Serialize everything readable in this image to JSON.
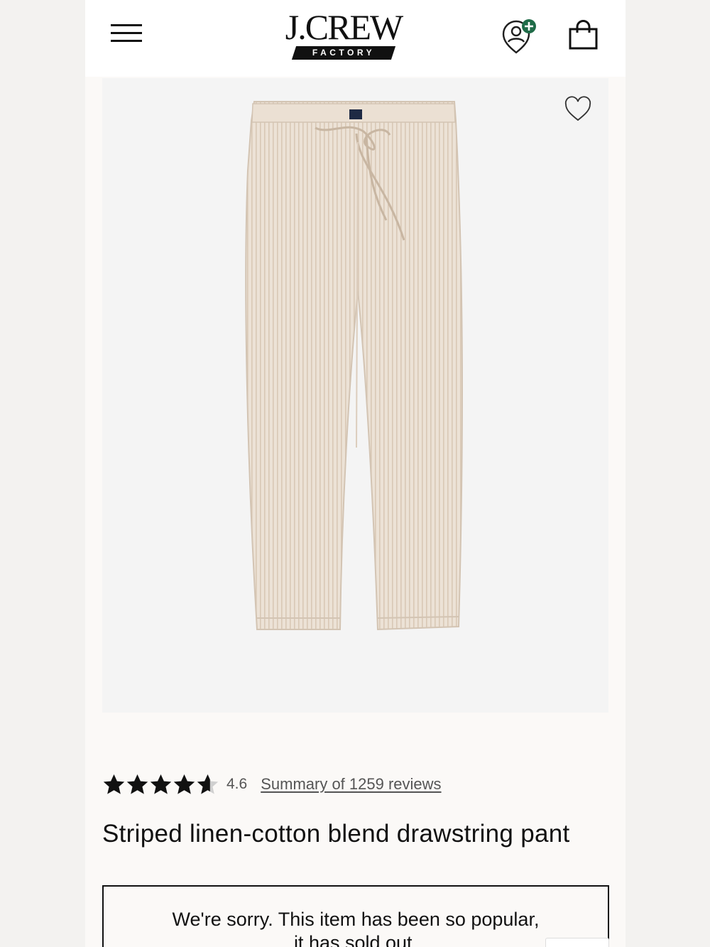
{
  "header": {
    "brand_name": "J.CREW",
    "brand_sub": "FACTORY",
    "icons": {
      "menu": "hamburger-menu-icon",
      "account": "account-add-icon",
      "bag": "shopping-bag-icon"
    },
    "account_badge_color": "#1f6b48"
  },
  "product": {
    "image_icon": "wishlist-heart-icon",
    "rating": {
      "value": "4.6",
      "stars": 4.6,
      "max_stars": 5,
      "reviews_link": "Summary of 1259 reviews"
    },
    "title": "Striped linen-cotton blend drawstring pant"
  },
  "notice": {
    "line1": "We're sorry. This item has been so popular,",
    "line2": "it has sold out."
  }
}
